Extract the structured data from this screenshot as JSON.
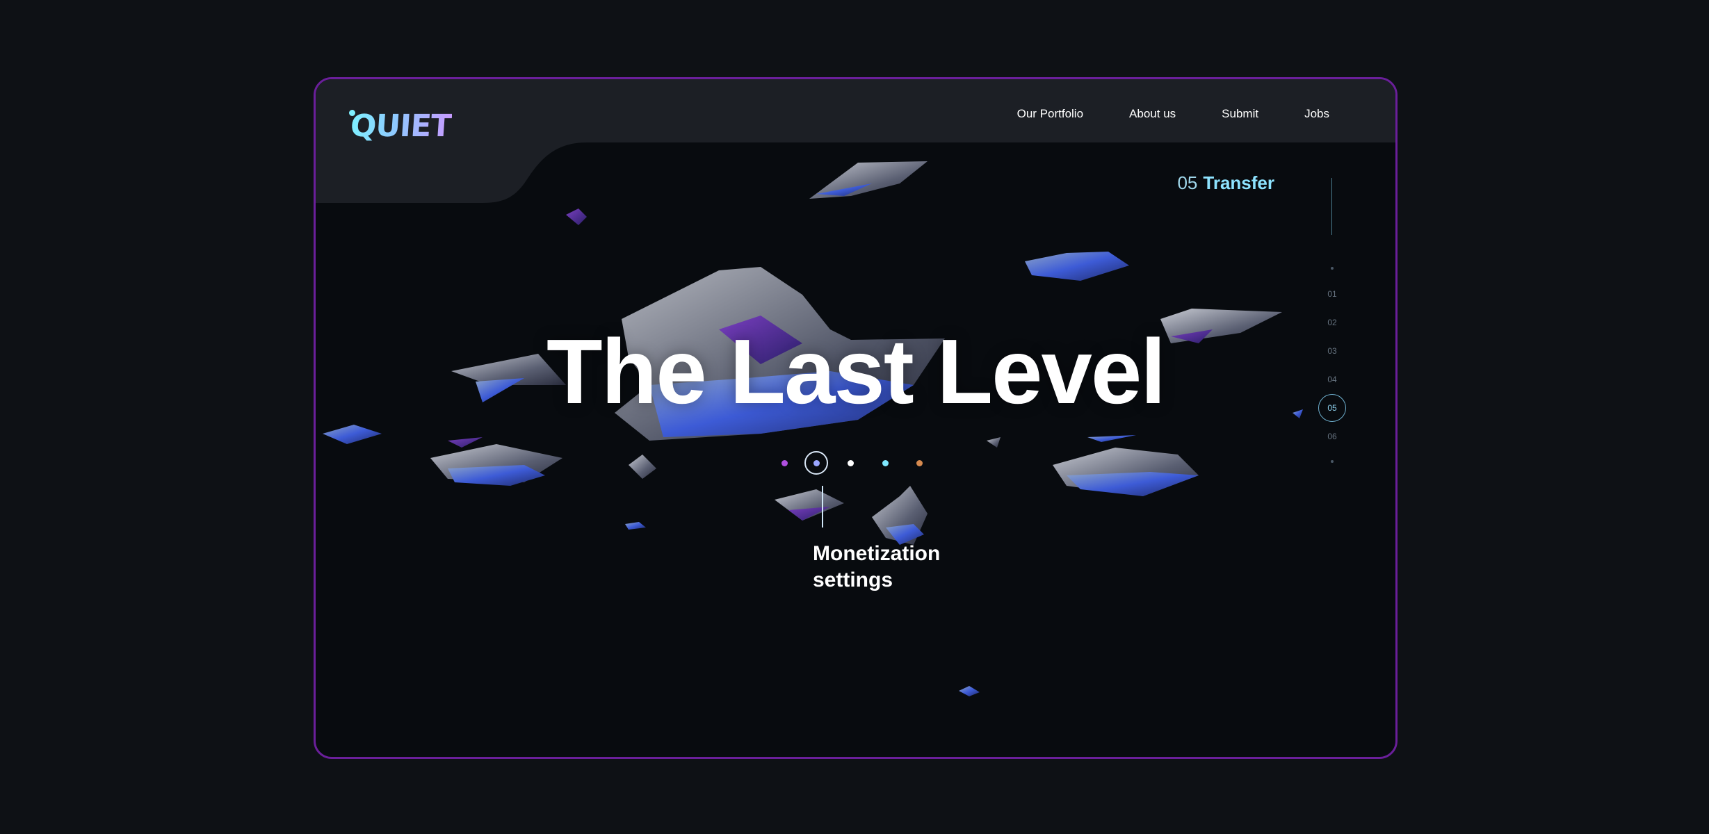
{
  "brand": {
    "logo_text": "QUIET"
  },
  "nav": {
    "items": [
      {
        "label": "Our Portfolio"
      },
      {
        "label": "About us"
      },
      {
        "label": "Submit"
      },
      {
        "label": "Jobs"
      }
    ]
  },
  "section": {
    "number": "05",
    "name": "Transfer"
  },
  "pager": {
    "pages": [
      "01",
      "02",
      "03",
      "04",
      "05",
      "06"
    ],
    "active": "05"
  },
  "hero": {
    "title": "The Last Level"
  },
  "steps": {
    "colors": [
      "#b04fe0",
      "#9aa6ff",
      "#ffffff",
      "#7fe9ff",
      "#d68a4f"
    ],
    "active_index": 1,
    "caption_line1": "Monetization",
    "caption_line2": "settings"
  },
  "colors": {
    "frame_border": "#6a1f9a",
    "accent": "#8ee3ff"
  }
}
